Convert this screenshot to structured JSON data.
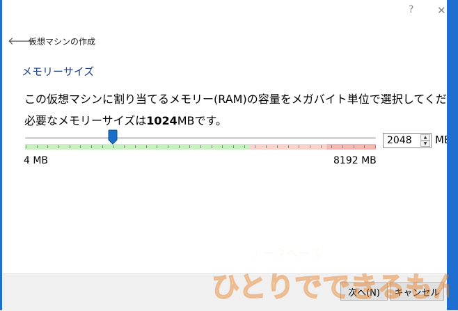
{
  "titlebar": {
    "help_label": "?",
    "close_label": "✕"
  },
  "header": {
    "back_icon": "arrow-left-icon",
    "title": "仮想マシンの作成"
  },
  "section": {
    "title": "メモリーサイズ"
  },
  "description": {
    "line1": "この仮想マシンに割り当てるメモリー(RAM)の容量をメガバイト単位で選択してください。",
    "line2_prefix": "必要なメモリーサイズは",
    "line2_bold": "1024",
    "line2_suffix": "MBです。"
  },
  "memory": {
    "slider_min": 4,
    "slider_max": 8192,
    "slider_value": 2048,
    "green_fraction": 0.64,
    "red_start_fraction": 0.86,
    "min_label": "4 MB",
    "max_label": "8192 MB",
    "spinbox_value": "2048",
    "unit": "MB"
  },
  "footer": {
    "next_label": "次へ(N)",
    "cancel_label": "キャンセル"
  },
  "watermark": {
    "line1": "データベース",
    "line2": "ひとりでできるもん"
  },
  "colors": {
    "accent": "#1e6fd0",
    "section_title": "#1c3e8a",
    "slider_green": "#c8f0c0",
    "slider_pink": "#f8d4cc",
    "slider_red": "#f4b8b2",
    "thumb": "#1a6fc7"
  }
}
